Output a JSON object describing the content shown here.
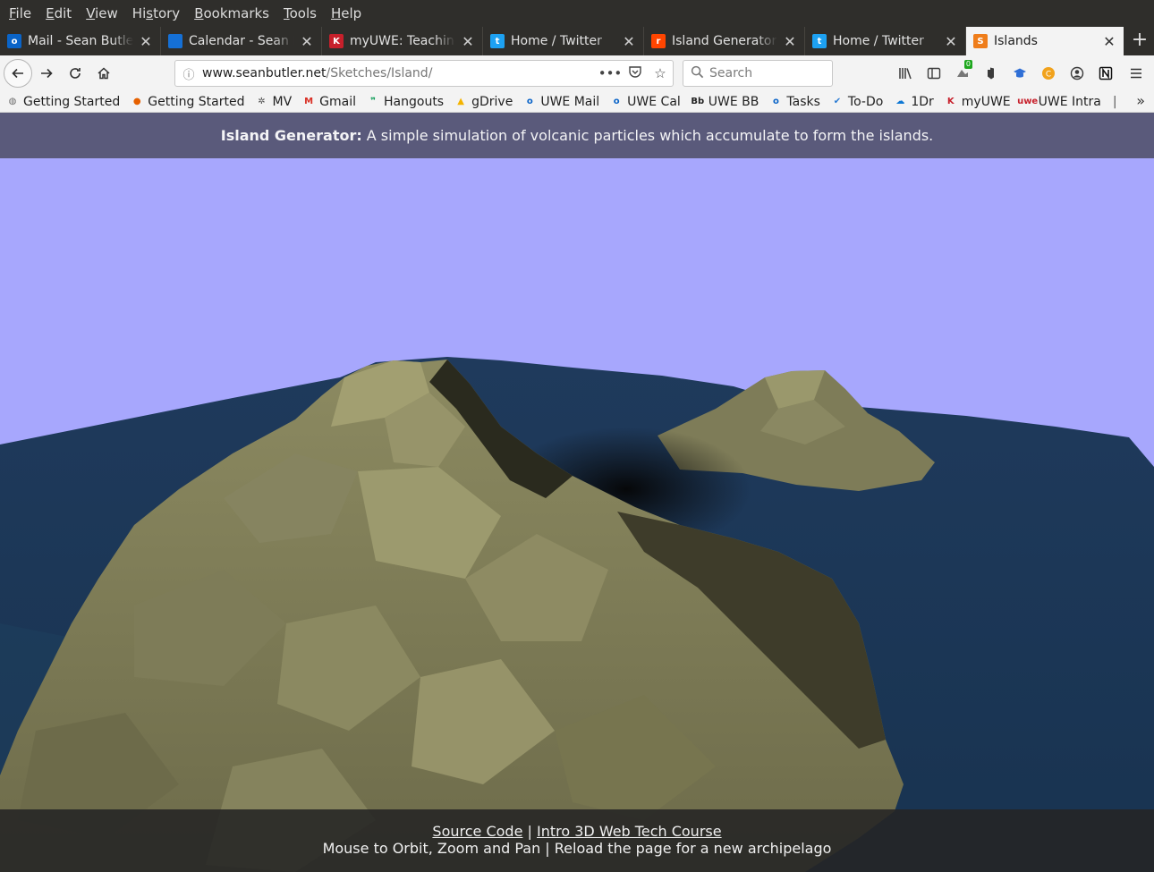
{
  "menubar": {
    "items": [
      "File",
      "Edit",
      "View",
      "History",
      "Bookmarks",
      "Tools",
      "Help"
    ],
    "access_keys": [
      "F",
      "E",
      "V",
      "s",
      "B",
      "T",
      "H"
    ]
  },
  "tabs": [
    {
      "title": "Mail - Sean Butler",
      "icon": "outlook-icon",
      "color": "#0a64c8",
      "glyph": "o"
    },
    {
      "title": "Calendar - Sean Butler",
      "icon": "outlook-calendar-icon",
      "color": "#1570d6",
      "glyph": ""
    },
    {
      "title": "myUWE: Teaching",
      "icon": "uwe-icon",
      "color": "#c7202b",
      "glyph": "K"
    },
    {
      "title": "Home / Twitter",
      "icon": "twitter-icon",
      "color": "#1da1f2",
      "glyph": "t"
    },
    {
      "title": "Island Generator",
      "icon": "reddit-icon",
      "color": "#ff4500",
      "glyph": "r"
    },
    {
      "title": "Home / Twitter",
      "icon": "twitter-icon",
      "color": "#1da1f2",
      "glyph": "t"
    },
    {
      "title": "Islands",
      "icon": "sketch-icon",
      "color": "#ef7d1a",
      "glyph": "S"
    }
  ],
  "navbar": {
    "url_host": "www.seanbutler.net",
    "url_path": "/Sketches/Island/",
    "search_placeholder": "Search",
    "badge_count": "0"
  },
  "bookmarks": [
    {
      "label": "Getting Started",
      "icon": "globe-icon",
      "color": "#6b6b6b",
      "glyph": "◍"
    },
    {
      "label": "Getting Started",
      "icon": "firefox-icon",
      "color": "#e66000",
      "glyph": "●"
    },
    {
      "label": "MV",
      "icon": "gear-icon",
      "color": "#555555",
      "glyph": "✲"
    },
    {
      "label": "Gmail",
      "icon": "gmail-icon",
      "color": "#d93025",
      "glyph": "M"
    },
    {
      "label": "Hangouts",
      "icon": "hangouts-icon",
      "color": "#0f9d58",
      "glyph": "❞"
    },
    {
      "label": "gDrive",
      "icon": "drive-icon",
      "color": "#f4b400",
      "glyph": "▲"
    },
    {
      "label": "UWE Mail",
      "icon": "outlook-icon",
      "color": "#0a64c8",
      "glyph": "o"
    },
    {
      "label": "UWE Cal",
      "icon": "outlook-icon",
      "color": "#0a64c8",
      "glyph": "o"
    },
    {
      "label": "UWE BB",
      "icon": "blackboard-icon",
      "color": "#222222",
      "glyph": "Bb"
    },
    {
      "label": "Tasks",
      "icon": "outlook-icon",
      "color": "#0a64c8",
      "glyph": "o"
    },
    {
      "label": "To-Do",
      "icon": "todo-check-icon",
      "color": "#2b7cd3",
      "glyph": "✔"
    },
    {
      "label": "1Dr",
      "icon": "onedrive-icon",
      "color": "#0f78d4",
      "glyph": "☁"
    },
    {
      "label": "myUWE",
      "icon": "uwe-icon",
      "color": "#c7202b",
      "glyph": "K"
    },
    {
      "label": "UWE Intra",
      "icon": "uwe-logo-icon",
      "color": "#c7202b",
      "glyph": "uwe"
    }
  ],
  "page": {
    "header_title": "Island Generator:",
    "header_text": "A simple simulation of volcanic particles which accumulate to form the islands.",
    "footer_link1": "Source Code",
    "footer_sep": "|",
    "footer_link2": "Intro 3D Web Tech Course",
    "footer_instructions": "Mouse to Orbit, Zoom and Pan | Reload the page for a new archipelago"
  },
  "colors": {
    "sky": "#a7a7fd",
    "sea": "#1f3a55",
    "land": "#8f8c64",
    "header_bg": "#5a5a7b"
  }
}
